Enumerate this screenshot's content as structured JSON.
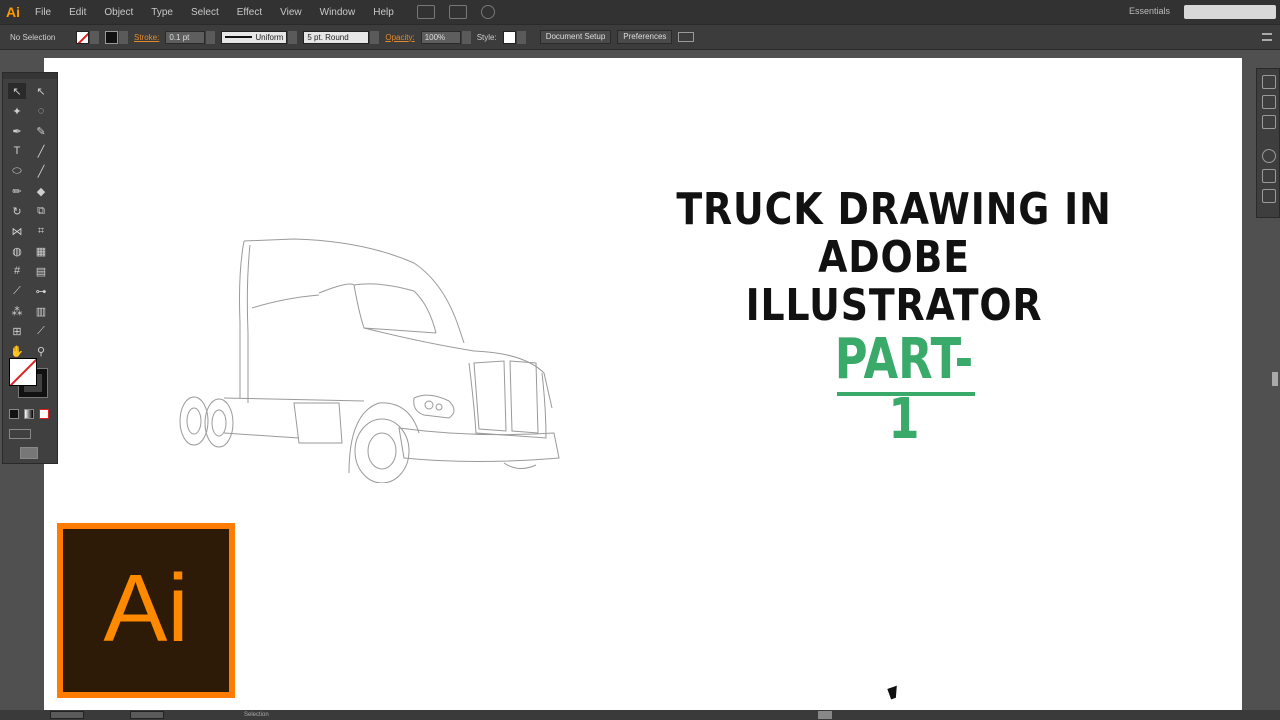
{
  "app": {
    "logo": "Ai"
  },
  "menu": [
    "File",
    "Edit",
    "Object",
    "Type",
    "Select",
    "Effect",
    "View",
    "Window",
    "Help"
  ],
  "workspace": "Essentials",
  "control_bar": {
    "selection": "No Selection",
    "stroke_label": "Stroke:",
    "stroke_weight": "0.1 pt",
    "profile": "Uniform",
    "brush": "5 pt. Round",
    "opacity_label": "Opacity:",
    "opacity": "100%",
    "style_label": "Style:",
    "document_setup": "Document Setup",
    "preferences": "Preferences"
  },
  "canvas": {
    "title_line1": "TRUCK DRAWING IN",
    "title_line2": "ADOBE ILLUSTRATOR",
    "part": "PART-1",
    "part_color": "#3aaa6a"
  },
  "logo_badge": {
    "text": "Ai",
    "border_color": "#ff7c00",
    "bg_color": "#2d1b08"
  },
  "status": {
    "tool": "Selection"
  }
}
